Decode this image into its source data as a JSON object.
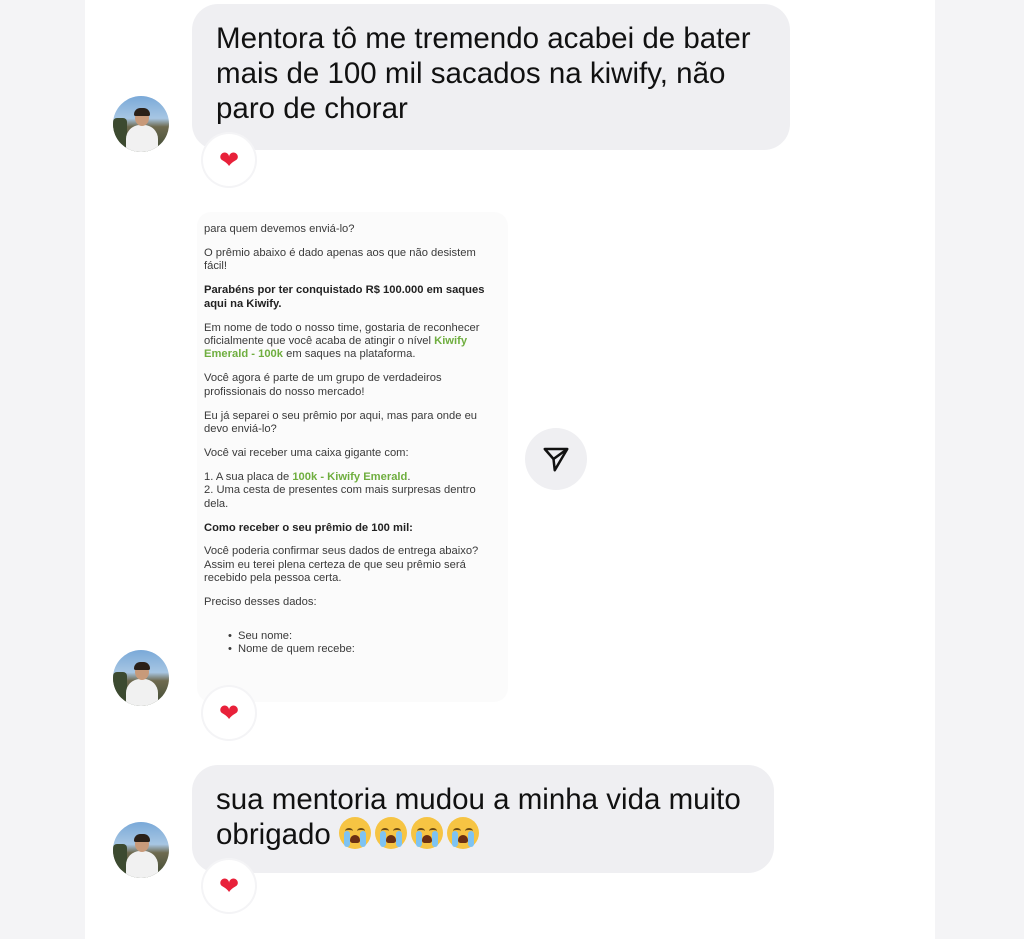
{
  "messages": [
    {
      "text": "Mentora tô me tremendo acabei de bater mais de 100 mil sacados na kiwify, não paro de chorar",
      "reaction": "❤"
    },
    {
      "reaction": "❤"
    },
    {
      "text": "sua mentoria mudou a minha vida muito obrigado",
      "reaction": "❤"
    }
  ],
  "emojis": [
    "loudly-crying-face",
    "loudly-crying-face",
    "loudly-crying-face",
    "loudly-crying-face"
  ],
  "shared_post": {
    "p1": "para quem devemos enviá-lo?",
    "p2": "O prêmio abaixo é dado apenas aos que não desistem fácil!",
    "p3_bold": "Parabéns por ter conquistado R$ 100.000 em saques aqui na Kiwify.",
    "p4_a": "Em nome de todo o nosso time, gostaria de reconhecer oficialmente que você acaba de atingir o nível ",
    "p4_green": "Kiwify Emerald - 100k",
    "p4_b": " em saques na plataforma.",
    "p5": "Você agora é parte de um grupo de verdadeiros profissionais do nosso mercado!",
    "p6": "Eu já separei o seu prêmio por aqui, mas para onde eu devo enviá-lo?",
    "p7": "Você vai receber uma caixa gigante com:",
    "item1_a": "1. A sua placa de ",
    "item1_green": "100k - Kiwify Emerald",
    "item1_b": ".",
    "item2": "2. Uma cesta de presentes com mais surpresas dentro dela.",
    "p8_bold": "Como receber o seu prêmio de 100 mil:",
    "p9": "Você poderia confirmar seus dados de entrega abaixo? Assim eu terei plena certeza de que seu prêmio será recebido pela pessoa certa.",
    "p10": "Preciso desses dados:",
    "bullet1": "Seu nome:",
    "bullet2": "Nome de quem recebe:"
  },
  "colors": {
    "accent_green": "#6fae3f",
    "bubble": "#efeff2",
    "heart": "#e8213a"
  }
}
